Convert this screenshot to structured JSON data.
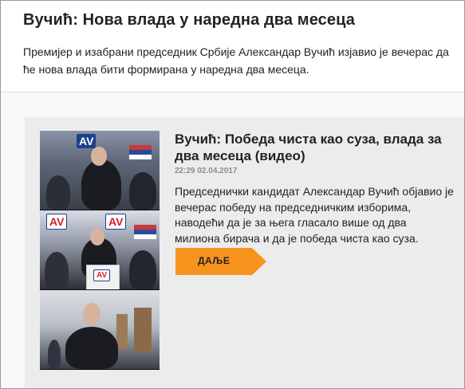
{
  "header": {
    "title": "Вучић: Нова влада у наредна два месеца",
    "lead": "Премијер и изабрани председник Србије Александар Вучић изјавио је вечерас да ће нова влада бити формирана у наредна два месеца."
  },
  "article": {
    "title": "Вучић: Победа чиста као суза, влада за два месеца (видео)",
    "timestamp": "22:29 02.04.2017",
    "summary": "Председнички кандидат Александар Вучић објавио је вечерас победу на председничким изборима, наводећи да је за њега гласало више од два милиона бирача и да је победа чиста као суза.",
    "more_label": "ДАЉЕ",
    "logo_text": "AV"
  },
  "colors": {
    "accent": "#f7941d",
    "card_bg": "#ececec",
    "title_text": "#1f2326"
  }
}
